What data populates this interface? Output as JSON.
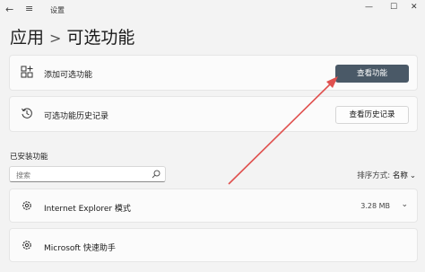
{
  "window": {
    "back_icon": "←",
    "menu_icon": "≡",
    "title": "设置",
    "minimize": "—",
    "maximize": "☐",
    "close": "✕"
  },
  "breadcrumb": {
    "parent": "应用",
    "separator": ">",
    "current": "可选功能"
  },
  "add_feature": {
    "label": "添加可选功能",
    "button": "查看功能"
  },
  "history": {
    "label": "可选功能历史记录",
    "button": "查看历史记录"
  },
  "installed": {
    "title": "已安装功能",
    "search_placeholder": "搜索",
    "sort_label": "排序方式:",
    "sort_value": "名称",
    "sort_chevron": "⌄",
    "features": [
      {
        "name": "Internet Explorer 模式",
        "size": "3.28 MB",
        "chevron": "⌄"
      },
      {
        "name": "Microsoft 快速助手",
        "size": "",
        "chevron": ""
      }
    ]
  },
  "colors": {
    "primary_button": "#4a5967",
    "annotation_arrow": "#e0514f"
  }
}
